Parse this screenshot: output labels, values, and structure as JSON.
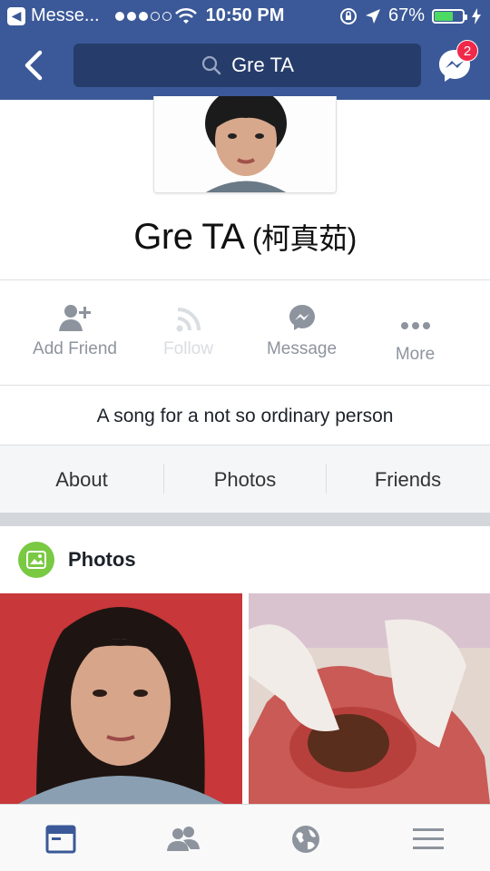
{
  "status_bar": {
    "back_app": "Messe...",
    "time": "10:50 PM",
    "battery": "67%",
    "battery_level": 0.67
  },
  "nav": {
    "search_text": "Gre TA",
    "messenger_badge": "2"
  },
  "profile": {
    "name": "Gre TA",
    "name_cjk": "(柯真茹)",
    "bio": "A song for a not so ordinary person"
  },
  "actions": [
    {
      "label": "Add Friend",
      "icon": "add-friend-icon"
    },
    {
      "label": "Follow",
      "icon": "follow-icon"
    },
    {
      "label": "Message",
      "icon": "messenger-icon"
    },
    {
      "label": "More",
      "icon": "more-icon"
    }
  ],
  "tabs": [
    {
      "label": "About"
    },
    {
      "label": "Photos"
    },
    {
      "label": "Friends"
    }
  ],
  "photos_section": {
    "title": "Photos"
  },
  "colors": {
    "brand": "#3b5998",
    "badge": "#f02849",
    "photos_icon": "#7ac943"
  }
}
